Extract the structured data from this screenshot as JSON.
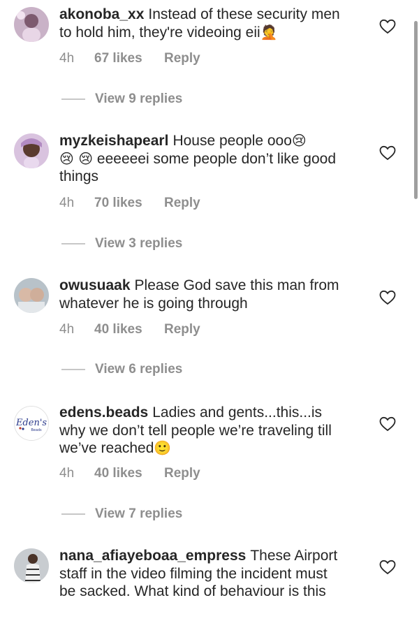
{
  "comments": [
    {
      "username": "akonoba_xx",
      "text": "Instead of these security men to hold him, they're videoing eii",
      "emoji": "🤦",
      "time": "4h",
      "likes": "67 likes",
      "reply": "Reply",
      "view_replies": "View 9 replies"
    },
    {
      "username": "myzkeishapearl",
      "text": "House people ooo",
      "emoji": "😢",
      "text2": "eeeeeei some people don’t like good things",
      "emoji2": "😢 😢",
      "time": "4h",
      "likes": "70 likes",
      "reply": "Reply",
      "view_replies": "View 3 replies"
    },
    {
      "username": "owusuaak",
      "text": "Please God save this man from whatever he is going through",
      "time": "4h",
      "likes": "40 likes",
      "reply": "Reply",
      "view_replies": "View 6 replies"
    },
    {
      "username": "edens.beads",
      "text": "Ladies and gents...this...is why we don’t tell people we’re traveling till we’ve reached",
      "emoji": "🙂",
      "avatar_logo": "Eden's",
      "avatar_logo_sub": "Beads",
      "time": "4h",
      "likes": "40 likes",
      "reply": "Reply",
      "view_replies": "View 7 replies"
    },
    {
      "username": "nana_afiayeboaa_empress",
      "text": "These Airport staff in the video filming the incident must be sacked. What kind of behaviour is this"
    }
  ],
  "icons": {
    "heart": "heart-outline-icon"
  },
  "colors": {
    "text": "#262626",
    "muted": "#8e8e8e",
    "divider": "#c7c7c7"
  }
}
